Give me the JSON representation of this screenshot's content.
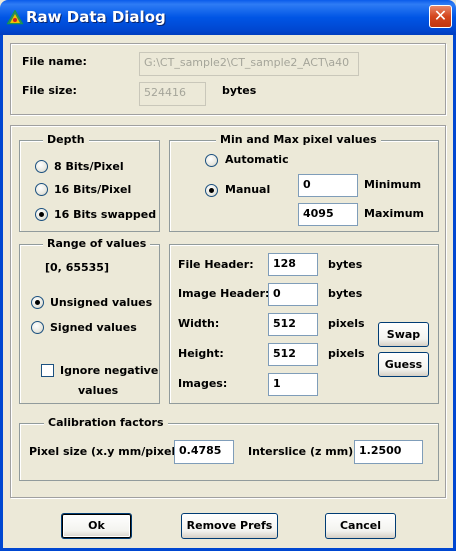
{
  "window": {
    "title": "Raw Data Dialog",
    "close_glyph": "✕"
  },
  "file": {
    "name_label": "File name:",
    "name_value": "G:\\CT_sample2\\CT_sample2_ACT\\a40",
    "size_label": "File size:",
    "size_value": "524416",
    "size_unit": "bytes"
  },
  "depth": {
    "title": "Depth",
    "options": [
      "8 Bits/Pixel",
      "16 Bits/Pixel",
      "16 Bits swapped"
    ],
    "selected": "16 Bits swapped"
  },
  "minmax": {
    "title": "Min and Max pixel values",
    "automatic_label": "Automatic",
    "manual_label": "Manual",
    "selected": "Manual",
    "min_value": "0",
    "min_label": "Minimum",
    "max_value": "4095",
    "max_label": "Maximum"
  },
  "range": {
    "title": "Range of values",
    "range_text": "[0, 65535]",
    "unsigned_label": "Unsigned values",
    "signed_label": "Signed values",
    "selected": "Unsigned values",
    "ignore_label_line1": "Ignore negative",
    "ignore_label_line2": "values",
    "ignore_checked": false
  },
  "header": {
    "file_header_label": "File Header:",
    "file_header_value": "128",
    "file_header_unit": "bytes",
    "image_header_label": "Image Header:",
    "image_header_value": "0",
    "image_header_unit": "bytes",
    "width_label": "Width:",
    "width_value": "512",
    "width_unit": "pixels",
    "height_label": "Height:",
    "height_value": "512",
    "height_unit": "pixels",
    "images_label": "Images:",
    "images_value": "1",
    "swap_label": "Swap",
    "guess_label": "Guess"
  },
  "calibration": {
    "title": "Calibration factors",
    "pixel_size_label": "Pixel size (x.y mm/pixel):",
    "pixel_size_value": "0.4785",
    "interslice_label": "Interslice (z mm):",
    "interslice_value": "1.2500"
  },
  "footer": {
    "ok_label": "Ok",
    "remove_prefs_label": "Remove Prefs",
    "cancel_label": "Cancel"
  },
  "colors": {
    "titlebar": "#0055E5",
    "dialog_bg": "#ECE9D8",
    "close_button": "#D4461E"
  }
}
